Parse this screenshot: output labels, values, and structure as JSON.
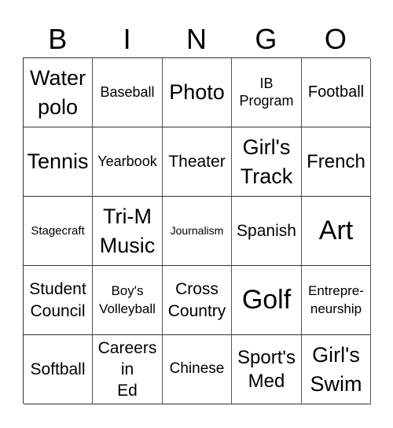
{
  "header": {
    "letters": [
      "B",
      "I",
      "N",
      "G",
      "O"
    ]
  },
  "grid": {
    "rows": [
      [
        "Water\npolo",
        "Baseball",
        "Photo",
        "IB\nProgram",
        "Football"
      ],
      [
        "Tennis",
        "Yearbook",
        "Theater",
        "Girl's\nTrack",
        "French"
      ],
      [
        "Stagecraft",
        "Tri-M\nMusic",
        "Journalism",
        "Spanish",
        "Art"
      ],
      [
        "Student\nCouncil",
        "Boy's\nVolleyball",
        "Cross\nCountry",
        "Golf",
        "Entrepre-\nneurship"
      ],
      [
        "Softball",
        "Careers\nin\nEd",
        "Chinese",
        "Sport's\nMed",
        "Girl's\nSwim"
      ]
    ]
  }
}
